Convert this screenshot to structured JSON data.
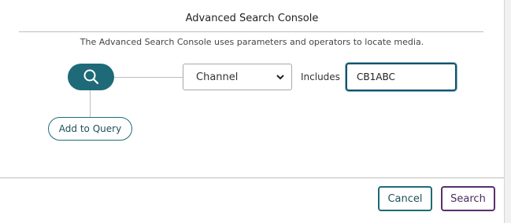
{
  "dialog": {
    "title": "Advanced Search Console",
    "description": "The Advanced Search Console uses parameters and operators to locate media."
  },
  "query": {
    "search_icon": "search-icon",
    "add_to_query_label": "Add to Query",
    "field": {
      "selected": "Channel",
      "options": [
        "Channel"
      ]
    },
    "operator_label": "Includes",
    "value": "CB1ABC"
  },
  "footer": {
    "cancel_label": "Cancel",
    "search_label": "Search"
  },
  "colors": {
    "accent": "#1e6a78",
    "search_button_border": "#5a2d6e",
    "input_focus_border": "#16536a"
  }
}
